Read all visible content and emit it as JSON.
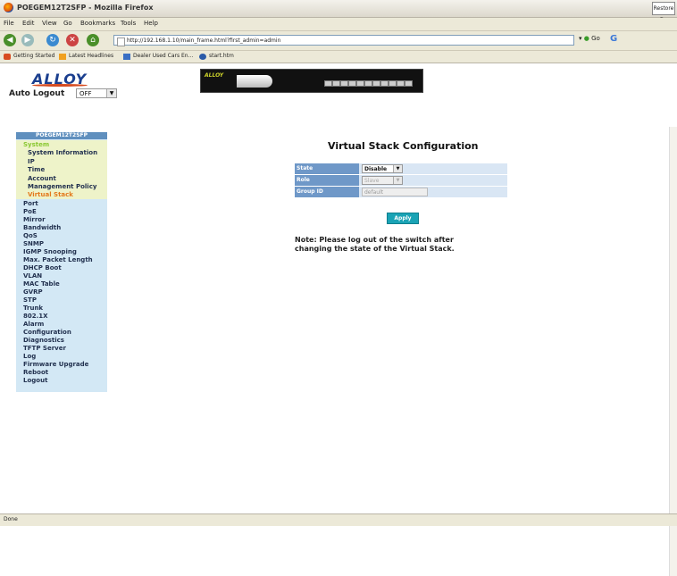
{
  "window": {
    "title": "POEGEM12T2SFP - Mozilla Firefox",
    "restore_label": "Restore Do"
  },
  "menu": [
    "File",
    "Edit",
    "View",
    "Go",
    "Bookmarks",
    "Tools",
    "Help"
  ],
  "navigation": {
    "url": "http://192.168.1.10/main_frame.html?first_admin=admin",
    "go_label": "Go",
    "search_icon_letter": "G"
  },
  "bookmarks": [
    "Getting Started",
    "Latest Headlines",
    "Dealer Used Cars En...",
    "start.htm"
  ],
  "header": {
    "logo_text": "ALLOY",
    "auto_logout_label": "Auto Logout",
    "auto_logout_value": "OFF",
    "device_brand": "ALLOY"
  },
  "sidebar": {
    "title": "POEGEM12T2SFP",
    "items": [
      {
        "label": "System",
        "level": 0,
        "active": false,
        "color": "#8ac832"
      },
      {
        "label": "System Information",
        "level": 1,
        "active": false
      },
      {
        "label": "IP",
        "level": 1,
        "active": false
      },
      {
        "label": "Time",
        "level": 1,
        "active": false
      },
      {
        "label": "Account",
        "level": 1,
        "active": false
      },
      {
        "label": "Management Policy",
        "level": 1,
        "active": false
      },
      {
        "label": "Virtual Stack",
        "level": 1,
        "active": true,
        "color": "#e3791c"
      },
      {
        "label": "Port",
        "level": 0
      },
      {
        "label": "PoE",
        "level": 0
      },
      {
        "label": "Mirror",
        "level": 0
      },
      {
        "label": "Bandwidth",
        "level": 0
      },
      {
        "label": "QoS",
        "level": 0
      },
      {
        "label": "SNMP",
        "level": 0
      },
      {
        "label": "IGMP Snooping",
        "level": 0
      },
      {
        "label": "Max. Packet Length",
        "level": 0
      },
      {
        "label": "DHCP Boot",
        "level": 0
      },
      {
        "label": "VLAN",
        "level": 0
      },
      {
        "label": "MAC Table",
        "level": 0
      },
      {
        "label": "GVRP",
        "level": 0
      },
      {
        "label": "STP",
        "level": 0
      },
      {
        "label": "Trunk",
        "level": 0
      },
      {
        "label": "802.1X",
        "level": 0
      },
      {
        "label": "Alarm",
        "level": 0
      },
      {
        "label": "Configuration",
        "level": 0
      },
      {
        "label": "Diagnostics",
        "level": 0
      },
      {
        "label": "TFTP Server",
        "level": 0
      },
      {
        "label": "Log",
        "level": 0
      },
      {
        "label": "Firmware Upgrade",
        "level": 0
      },
      {
        "label": "Reboot",
        "level": 0
      },
      {
        "label": "Logout",
        "level": 0
      }
    ]
  },
  "main": {
    "title": "Virtual Stack Configuration",
    "rows": [
      {
        "label": "State",
        "value": "Disable",
        "kind": "select",
        "enabled": true
      },
      {
        "label": "Role",
        "value": "Slave",
        "kind": "select",
        "enabled": false
      },
      {
        "label": "Group ID",
        "value": "default",
        "kind": "input",
        "enabled": false
      }
    ],
    "apply_label": "Apply",
    "note": "Note: Please log out of the switch after changing the state of the Virtual Stack."
  },
  "status": {
    "text": "Done"
  }
}
